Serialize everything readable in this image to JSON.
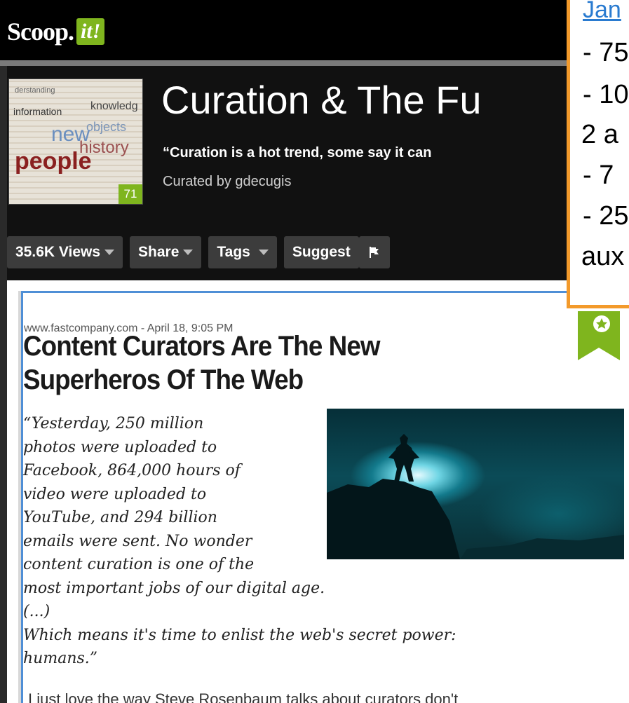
{
  "site": {
    "logo_text": "Scoop.",
    "logo_badge": "it!"
  },
  "topic": {
    "title": "Curation & The Fu",
    "tagline": "“Curation is a hot trend, some say it can",
    "curator": "Curated by gdecugis",
    "thumb_count": "71",
    "thumb_words": [
      "information",
      "new",
      "people",
      "history",
      "knowledg",
      "objects",
      "derstanding"
    ]
  },
  "toolbar": {
    "views_label": "35.6K Views",
    "share_label": "Share",
    "tags_label": "Tags",
    "suggest_label": "Suggest"
  },
  "post": {
    "source": "www.fastcompany.com - April 18, 9:05 PM",
    "title": "Content Curators Are The New Superheros Of The Web",
    "quote_lines": [
      "“Yesterday, 250 million",
      "photos were uploaded to",
      "Facebook, 864,000 hours of",
      "video were uploaded to",
      "YouTube, and 294 billion",
      "emails were sent. No wonder",
      "content curation is one of the",
      "most important jobs of our digital age.",
      "(...)",
      "Which means it's time to enlist the web's secret power:",
      "humans.”"
    ],
    "trailing_text": "I just love the way Steve Rosenbaum talks about curators don't"
  },
  "overlay": {
    "lines": [
      "Jan",
      "- 75",
      "- 10",
      "2 a",
      "- 7",
      "- 25",
      "aux"
    ]
  },
  "colors": {
    "accent_green": "#7fb51e",
    "overlay_border": "#f39a2b",
    "card_border": "#4f8fd6",
    "link_blue": "#2a7bd0"
  }
}
